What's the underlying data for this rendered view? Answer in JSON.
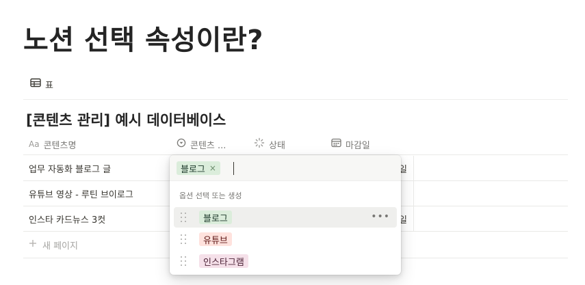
{
  "page": {
    "title": "노션 선택 속성이란?"
  },
  "view": {
    "icon": "table-icon",
    "tab_label": "표"
  },
  "database": {
    "title": "[콘텐츠 관리] 예시 데이터베이스",
    "columns": [
      {
        "icon": "text-property-icon",
        "icon_text": "Aa",
        "label": "콘텐츠명"
      },
      {
        "icon": "select-property-icon",
        "label": "콘텐츠 ..."
      },
      {
        "icon": "status-property-icon",
        "label": "상태"
      },
      {
        "icon": "date-property-icon",
        "label": "마감일"
      }
    ],
    "rows": [
      {
        "name": "업무 자동화 블로그 글",
        "tail": "일"
      },
      {
        "name": "유튜브 영상 - 루틴 브이로그",
        "tail": ""
      },
      {
        "name": "인스타 카드뉴스 3컷",
        "tail": "일"
      }
    ],
    "new_page_label": "새 페이지"
  },
  "dropdown": {
    "selected_chip": {
      "label": "블로그",
      "remove_symbol": "×"
    },
    "caption": "옵션 선택 또는 생성",
    "options": [
      {
        "label": "블로그",
        "color": "green",
        "hovered": true
      },
      {
        "label": "유튜브",
        "color": "red",
        "hovered": false
      },
      {
        "label": "인스타그램",
        "color": "pink",
        "hovered": false
      }
    ],
    "more_symbol": "•••"
  },
  "colors": {
    "green_chip_bg": "#dbeddb",
    "red_chip_bg": "#ffe2dd",
    "pink_chip_bg": "#f5e0e9",
    "text": "#37352f",
    "muted": "#787774"
  }
}
